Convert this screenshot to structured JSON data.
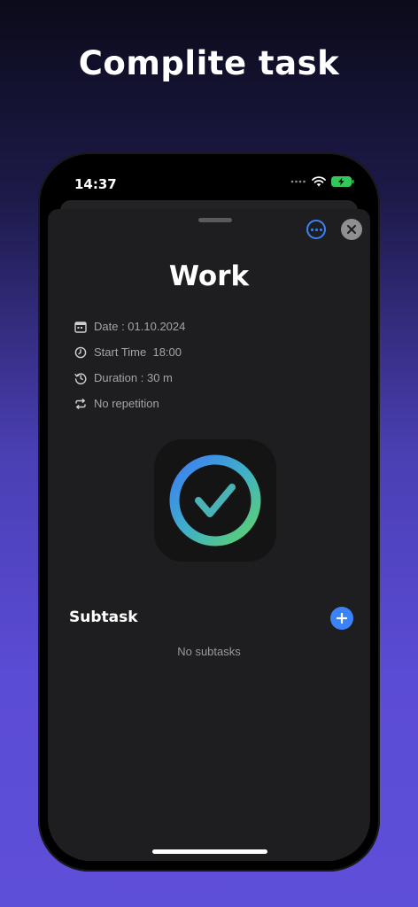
{
  "headline": "Complite task",
  "status_bar": {
    "time": "14:37"
  },
  "task": {
    "title": "Work",
    "date": "Date : 01.10.2024",
    "start_time": "Start Time  18:00",
    "duration": "Duration : 30 m",
    "repetition": "No repetition"
  },
  "subtasks": {
    "label": "Subtask",
    "empty_text": "No subtasks"
  },
  "icons": {
    "calendar": "calendar-icon",
    "clock": "clock-icon",
    "history": "history-icon",
    "repeat": "repeat-icon",
    "more": "more-icon",
    "close": "close-icon",
    "add": "plus-icon",
    "check": "check-circle-icon"
  },
  "colors": {
    "accent": "#3b82f6",
    "sheet": "#1e1e20",
    "battery": "#34c759"
  }
}
